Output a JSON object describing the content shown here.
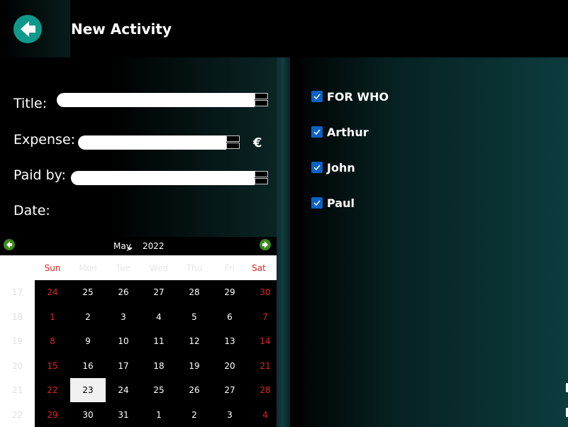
{
  "header": {
    "title": "New Activity",
    "back_icon": "arrow-left-circle-icon"
  },
  "form": {
    "title_label": "Title:",
    "title_value": "",
    "expense_label": "Expense:",
    "expense_value": "",
    "currency": "€",
    "paid_by_label": "Paid by:",
    "paid_by_value": "",
    "date_label": "Date:"
  },
  "calendar": {
    "month": "May",
    "year": "2022",
    "days_of_week": [
      "Sun",
      "Mon",
      "Tue",
      "Wed",
      "Thu",
      "Fri",
      "Sat"
    ],
    "week_numbers": [
      "17",
      "18",
      "19",
      "20",
      "21",
      "22"
    ],
    "weeks": [
      [
        "24",
        "25",
        "26",
        "27",
        "28",
        "29",
        "30"
      ],
      [
        "1",
        "2",
        "3",
        "4",
        "5",
        "6",
        "7"
      ],
      [
        "8",
        "9",
        "10",
        "11",
        "12",
        "13",
        "14"
      ],
      [
        "15",
        "16",
        "17",
        "18",
        "19",
        "20",
        "21"
      ],
      [
        "22",
        "23",
        "24",
        "25",
        "26",
        "27",
        "28"
      ],
      [
        "29",
        "30",
        "31",
        "1",
        "2",
        "3",
        "4"
      ]
    ],
    "selected": "23",
    "colors": {
      "weekend": "#e2241a",
      "nav": "#3d8a1e"
    }
  },
  "participants": {
    "header_label": "FOR WHO",
    "items": [
      {
        "label": "Arthur",
        "checked": true
      },
      {
        "label": "John",
        "checked": true
      },
      {
        "label": "Paul",
        "checked": true
      }
    ]
  },
  "colors": {
    "accent": "#0e9a8b",
    "checkbox": "#0b62c4"
  }
}
